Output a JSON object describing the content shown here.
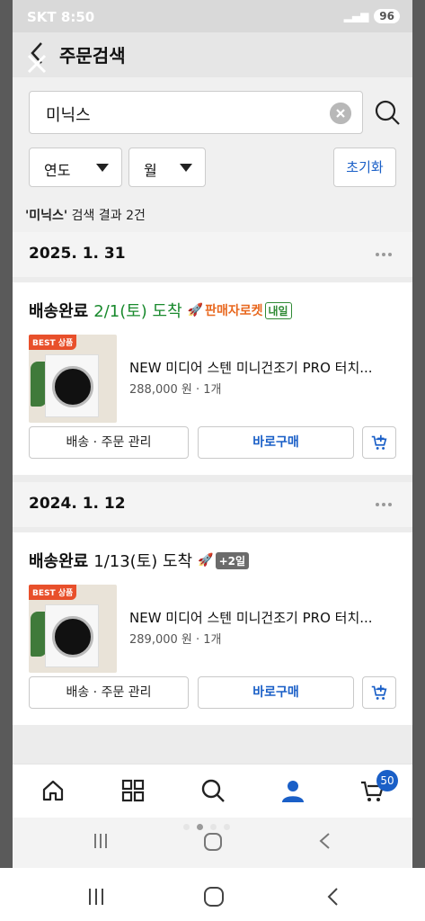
{
  "status_bar": {
    "carrier_time": "SKT 8:50",
    "battery": "96"
  },
  "header": {
    "title": "주문검색"
  },
  "search": {
    "value": "미닉스"
  },
  "filters": {
    "year": "연도",
    "month": "월",
    "reset": "초기화"
  },
  "summary": {
    "keyword": "'미닉스'",
    "rest": " 검색 결과 2건"
  },
  "orders": [
    {
      "date": "2025. 1. 31",
      "status": "배송완료",
      "arrival": "2/1(토) 도착",
      "rocket_label": "판매자로켓",
      "rocket_badge": "내일",
      "best_label": "BEST 상품",
      "product_name": "NEW 미디어 스텐 미니건조기 PRO 터치...",
      "price": "288,000 원 · 1개",
      "manage_label": "배송 · 주문 관리",
      "buy_label": "바로구매"
    },
    {
      "date": "2024. 1. 12",
      "status": "배송완료",
      "arrival": "1/13(토) 도착",
      "rocket_badge": "+2일",
      "best_label": "BEST 상품",
      "product_name": "NEW 미디어 스텐 미니건조기 PRO 터치...",
      "price": "289,000 원 · 1개",
      "manage_label": "배송 · 주문 관리",
      "buy_label": "바로구매"
    }
  ],
  "bottom_nav": {
    "cart_count": "50"
  },
  "colors": {
    "accent": "#1a5fc7",
    "green": "#1a8a2e",
    "rocket_orange": "#e8681f"
  }
}
